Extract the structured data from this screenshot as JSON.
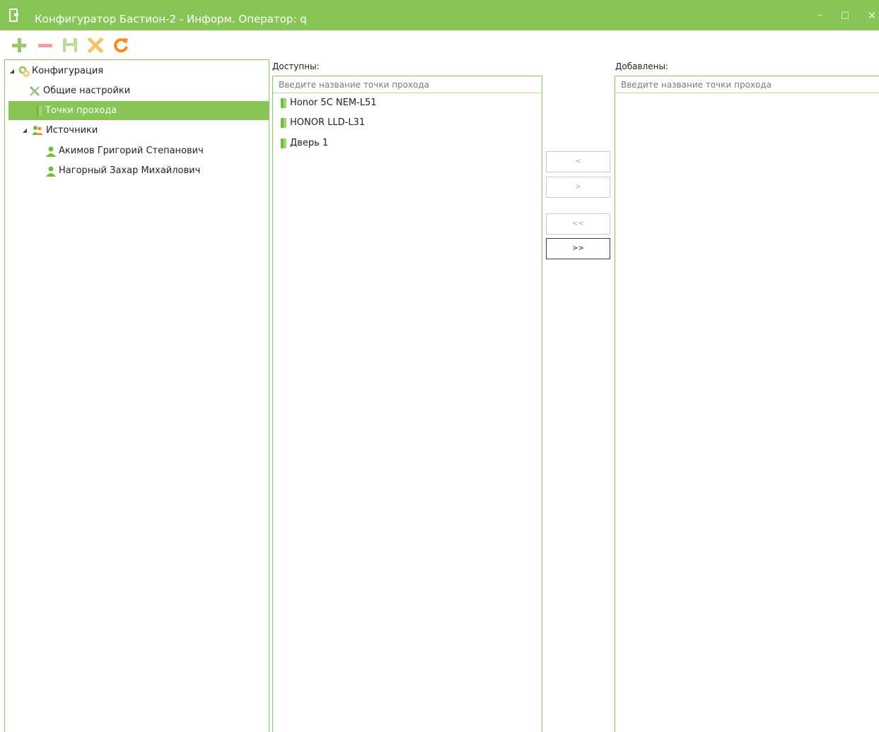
{
  "window": {
    "title": "Конфигуратор Бастион-2 - Информ. Оператор: q",
    "minimize": "–",
    "maximize": "□",
    "close": "✕"
  },
  "toolbar": {
    "add": "add",
    "remove": "remove",
    "save": "save",
    "delete": "delete",
    "refresh": "refresh"
  },
  "tree": {
    "root": "Конфигурация",
    "general_settings": "Общие настройки",
    "access_points": "Точки прохода",
    "sources": "Источники",
    "source_1": "Акимов Григорий Степанович",
    "source_2": "Нагорный Захар Михайлович"
  },
  "available": {
    "label": "Доступны:",
    "placeholder": "Введите название точки прохода",
    "items": [
      "Honor 5C NEM-L51",
      "HONOR LLD-L31",
      "Дверь 1"
    ]
  },
  "added": {
    "label": "Добавлены:",
    "placeholder": "Введите название точки прохода",
    "items": []
  },
  "transfer": {
    "move_left": "<",
    "move_right": ">",
    "move_all_left": "<<",
    "move_all_right": ">>"
  },
  "colors": {
    "accent": "#86c556",
    "border": "#8cc365",
    "door_icon": "#6fbf3a",
    "user_icon": "#6fbf3a",
    "remove_icon": "#f4a0a0",
    "delete_icon": "#f5c36a",
    "refresh_icon": "#f58a1f"
  }
}
